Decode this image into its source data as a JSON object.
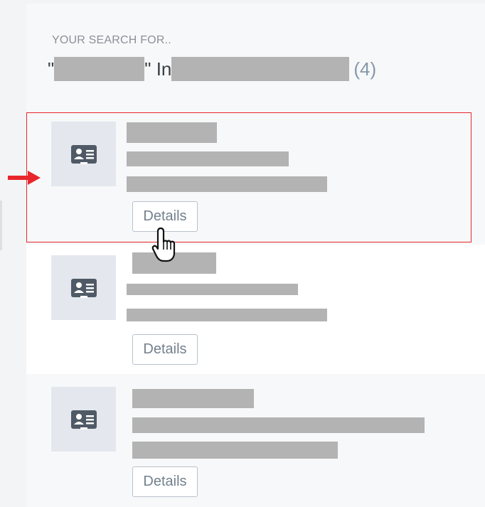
{
  "search": {
    "heading": "YOUR SEARCH FOR..",
    "open_quote": "\"",
    "close_quote_in": "\" In",
    "count": "(4)"
  },
  "results": [
    {
      "icon": "contact-card-icon",
      "button_label": "Details"
    },
    {
      "icon": "contact-card-icon",
      "button_label": "Details"
    },
    {
      "icon": "contact-card-icon",
      "button_label": "Details"
    }
  ],
  "annotations": {
    "highlight_color": "#e8262b",
    "pointer_icon": "hand-pointer-icon",
    "arrow_icon": "right-arrow-icon"
  },
  "colors": {
    "panel_bg": "#f7f8f9",
    "redaction": "#b3b3b3",
    "avatar_bg": "#e4e8ee",
    "icon_fg": "#4f5a66",
    "button_text": "#73808d",
    "count_text": "#8797a8"
  }
}
